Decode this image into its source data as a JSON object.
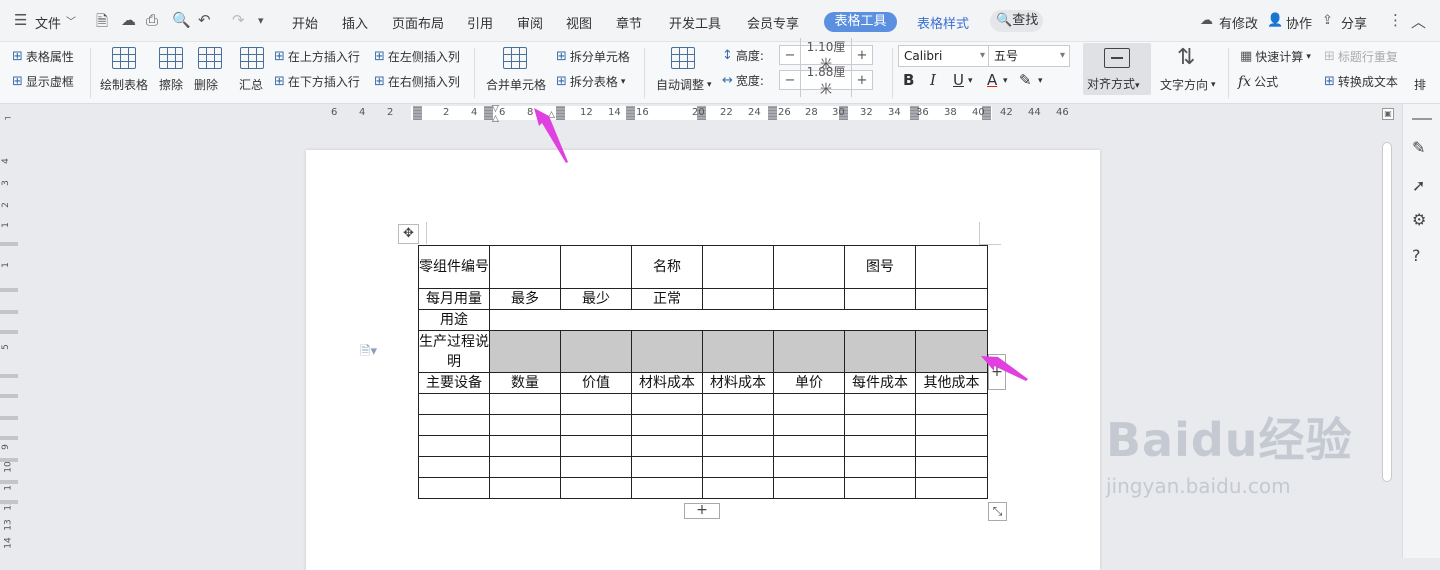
{
  "menubar": {
    "menu_label": "文件",
    "tabs": [
      "开始",
      "插入",
      "页面布局",
      "引用",
      "审阅",
      "视图",
      "章节",
      "开发工具",
      "会员专享"
    ],
    "active_tab": "表格工具",
    "secondary_tab": "表格样式",
    "search_label": "查找",
    "modified_label": "有修改",
    "collab_label": "协作",
    "share_label": "分享"
  },
  "ribbon": {
    "table_props": "表格属性",
    "show_gridlines": "显示虚框",
    "draw_table": "绘制表格",
    "erase": "擦除",
    "delete": "删除",
    "summary": "汇总",
    "insert_above": "在上方插入行",
    "insert_below": "在下方插入行",
    "insert_left": "在左侧插入列",
    "insert_right": "在右侧插入列",
    "merge_cells": "合并单元格",
    "split_cells": "拆分单元格",
    "split_table": "拆分表格",
    "auto_fit": "自动调整",
    "height_label": "高度:",
    "height_value": "1.10厘米",
    "width_label": "宽度:",
    "width_value": "1.88厘米",
    "font_name": "Calibri",
    "font_size": "五号",
    "alignment": "对齐方式",
    "text_direction": "文字方向",
    "quick_calc": "快速计算",
    "repeat_header": "标题行重复",
    "formula": "公式",
    "convert_text": "转换成文本",
    "more": "排"
  },
  "ruler_numbers": [
    "6",
    "4",
    "2",
    "2",
    "4",
    "6",
    "8",
    "12",
    "14",
    "16",
    "20",
    "22",
    "24",
    "26",
    "28",
    "30",
    "32",
    "34",
    "36",
    "38",
    "40",
    "42",
    "44",
    "46"
  ],
  "vruler_numbers": [
    "4",
    "3",
    "2",
    "1",
    "1",
    "5",
    "9",
    "10",
    "11",
    "12",
    "13",
    "14"
  ],
  "table": {
    "rows": [
      [
        "零组件编号",
        "",
        "",
        "名称",
        "",
        "",
        "图号",
        ""
      ],
      [
        "每月用量",
        "最多",
        "最少",
        "正常",
        "",
        "",
        "",
        ""
      ],
      [
        "用途",
        "",
        "",
        "",
        "",
        "",
        "",
        ""
      ],
      [
        "生产过程说明",
        "",
        "",
        "",
        "",
        "",
        "",
        ""
      ],
      [
        "主要设备",
        "数量",
        "价值",
        "材料成本",
        "材料成本",
        "单价",
        "每件成本",
        "其他成本"
      ],
      [
        "",
        "",
        "",
        "",
        "",
        "",
        "",
        ""
      ],
      [
        "",
        "",
        "",
        "",
        "",
        "",
        "",
        ""
      ],
      [
        "",
        "",
        "",
        "",
        "",
        "",
        "",
        ""
      ],
      [
        "",
        "",
        "",
        "",
        "",
        "",
        "",
        ""
      ],
      [
        "",
        "",
        "",
        "",
        "",
        "",
        "",
        ""
      ]
    ]
  },
  "watermark": {
    "line1": "Baidu经验",
    "line2": "jingyan.baidu.com"
  },
  "colors": {
    "accent": "#5b8fe0",
    "selected_cell": "#c9c9c9",
    "annotation_arrow": "#e040e0"
  }
}
